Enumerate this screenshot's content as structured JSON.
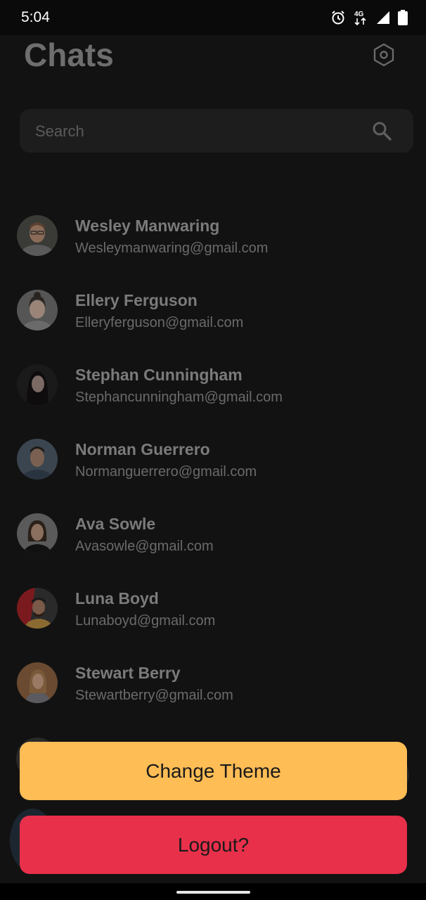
{
  "status_bar": {
    "time": "5:04",
    "network_label": "4G",
    "icons": [
      "alarm-icon",
      "network-4g-icon",
      "signal-icon",
      "battery-icon"
    ]
  },
  "header": {
    "title": "Chats",
    "settings_icon": "hexagon-settings-icon"
  },
  "search": {
    "placeholder": "Search",
    "icon": "search-icon"
  },
  "contacts": [
    {
      "name": "Wesley Manwaring",
      "email": "Wesleymanwaring@gmail.com"
    },
    {
      "name": "Ellery Ferguson",
      "email": "Elleryferguson@gmail.com"
    },
    {
      "name": "Stephan Cunningham",
      "email": "Stephancunningham@gmail.com"
    },
    {
      "name": "Norman Guerrero",
      "email": "Normanguerrero@gmail.com"
    },
    {
      "name": "Ava Sowle",
      "email": "Avasowle@gmail.com"
    },
    {
      "name": "Luna Boyd",
      "email": "Lunaboyd@gmail.com"
    },
    {
      "name": "Stewart Berry",
      "email": "Stewartberry@gmail.com"
    }
  ],
  "actions": {
    "change_theme": "Change Theme",
    "logout": "Logout?"
  },
  "colors": {
    "background": "#121212",
    "theme_button": "#ffbd55",
    "logout_button": "#e8304b"
  }
}
